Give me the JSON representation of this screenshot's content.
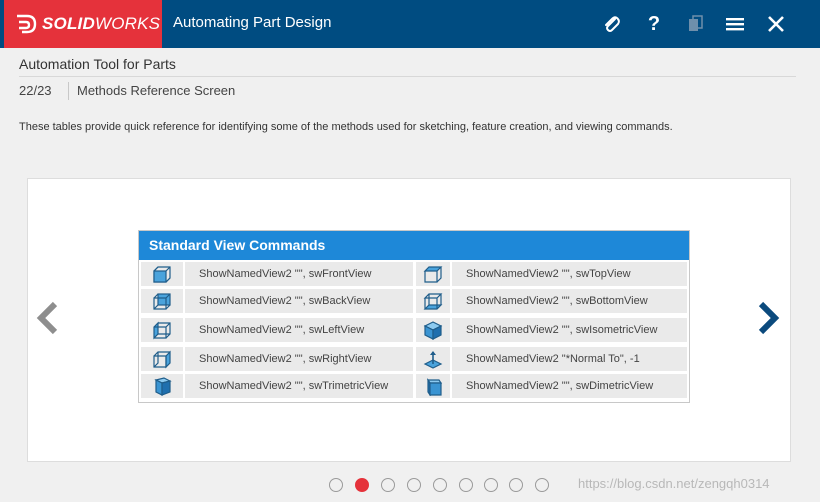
{
  "header": {
    "logo_bold": "SOLID",
    "logo_rest": "WORKS",
    "title": "Automating Part Design",
    "icons": [
      "paperclip-icon",
      "help-icon",
      "tablet-icon",
      "menu-icon",
      "close-icon"
    ]
  },
  "course": {
    "title": "Automation Tool for Parts",
    "page": "22/23",
    "screen": "Methods Reference Screen"
  },
  "description": "These tables provide quick reference for identifying some of the methods used for sketching, feature creation, and viewing commands.",
  "table": {
    "title": "Standard View Commands",
    "rows": [
      {
        "left": {
          "icon": "front-view-icon",
          "text": "ShowNamedView2 \"\", swFrontView"
        },
        "right": {
          "icon": "top-view-icon",
          "text": "ShowNamedView2 \"\", swTopView"
        }
      },
      {
        "left": {
          "icon": "back-view-icon",
          "text": "ShowNamedView2 \"\", swBackView"
        },
        "right": {
          "icon": "bottom-view-icon",
          "text": "ShowNamedView2 \"\", swBottomView"
        }
      },
      {
        "left": {
          "icon": "left-view-icon",
          "text": "ShowNamedView2 \"\", swLeftView"
        },
        "right": {
          "icon": "isometric-view-icon",
          "text": "ShowNamedView2 \"\", swIsometricView"
        }
      },
      {
        "left": {
          "icon": "right-view-icon",
          "text": "ShowNamedView2 \"\", swRightView"
        },
        "right": {
          "icon": "normal-to-icon",
          "text": "ShowNamedView2 \"*Normal To\", -1"
        }
      },
      {
        "left": {
          "icon": "trimetric-view-icon",
          "text": "ShowNamedView2 \"\", swTrimetricView"
        },
        "right": {
          "icon": "dimetric-view-icon",
          "text": "ShowNamedView2 \"\", swDimetricView"
        }
      }
    ]
  },
  "pagination": {
    "count": 9,
    "active_index": 1
  },
  "nav": {
    "prev_icon": "chevron-left-icon",
    "next_icon": "chevron-right-icon"
  },
  "watermark": "https://blog.csdn.net/zengqh0314",
  "colors": {
    "brand_red": "#e5323b",
    "header_blue": "#004c81",
    "table_blue": "#1e88d8",
    "next_arrow": "#0b4a7d",
    "prev_arrow": "#8e8e8e"
  }
}
